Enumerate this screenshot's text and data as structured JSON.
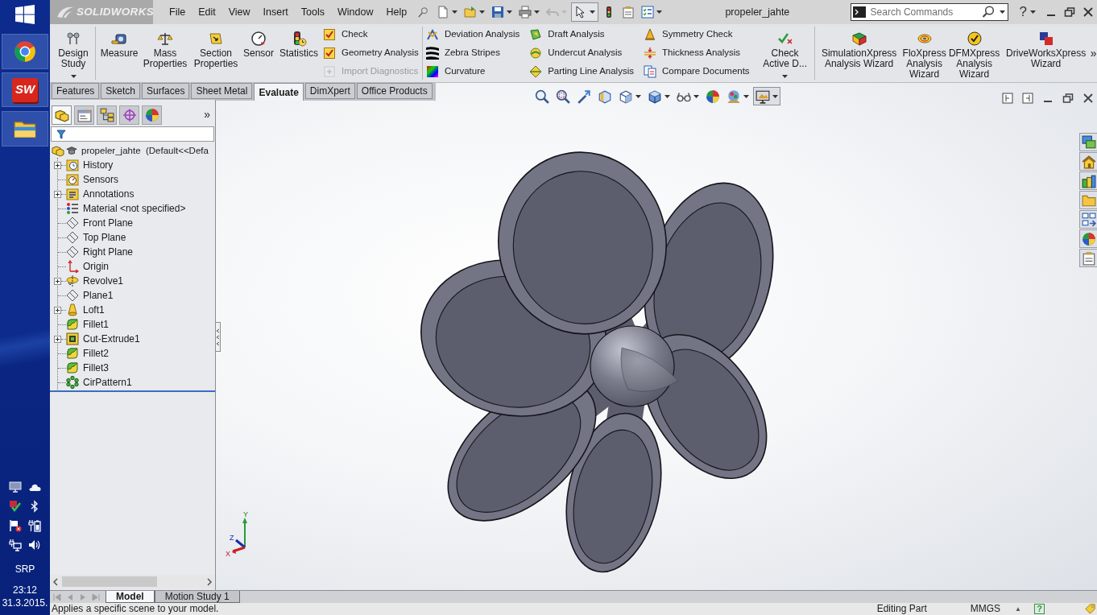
{
  "taskbar": {
    "app_badge": "SW",
    "language": "SRP",
    "time": "23:12",
    "date": "31.3.2015."
  },
  "title_bar": {
    "logo_text": "SOLIDWORKS",
    "menus": [
      "File",
      "Edit",
      "View",
      "Insert",
      "Tools",
      "Window",
      "Help"
    ],
    "quick_access": [
      {
        "kind": "new",
        "pressed": false,
        "disabled": false
      },
      {
        "kind": "open",
        "pressed": false,
        "disabled": false
      },
      {
        "kind": "save",
        "pressed": false,
        "disabled": false
      },
      {
        "kind": "print",
        "pressed": false,
        "disabled": false
      },
      {
        "kind": "undo",
        "pressed": false,
        "disabled": true
      },
      {
        "kind": "select",
        "pressed": true,
        "disabled": false
      },
      {
        "kind": "rebuild",
        "pressed": false,
        "disabled": false
      },
      {
        "kind": "options",
        "pressed": false,
        "disabled": false
      },
      {
        "kind": "list",
        "pressed": false,
        "disabled": false
      }
    ],
    "document_title": "propeler_jahte",
    "search": {
      "placeholder": "Search Commands"
    },
    "help": "?"
  },
  "ribbon": {
    "groups": [
      {
        "items": [
          {
            "kind": "large",
            "label": "Design Study",
            "dropdown": true
          }
        ]
      },
      {
        "items": [
          {
            "kind": "large",
            "label": "Measure",
            "dropdown": false
          },
          {
            "kind": "large",
            "label": "Mass Properties",
            "dropdown": false
          },
          {
            "kind": "large",
            "label": "Section Properties",
            "dropdown": false
          },
          {
            "kind": "large",
            "label": "Sensor",
            "dropdown": false
          },
          {
            "kind": "large",
            "label": "Statistics",
            "dropdown": false
          },
          {
            "kind": "stack",
            "buttons": [
              {
                "label": "Check",
                "disabled": false
              },
              {
                "label": "Geometry Analysis",
                "disabled": false
              },
              {
                "label": "Import Diagnostics",
                "disabled": true
              }
            ]
          }
        ]
      },
      {
        "items": [
          {
            "kind": "stack",
            "buttons": [
              {
                "label": "Deviation Analysis",
                "disabled": false
              },
              {
                "label": "Zebra Stripes",
                "disabled": false
              },
              {
                "label": "Curvature",
                "disabled": false
              }
            ]
          },
          {
            "kind": "stack",
            "buttons": [
              {
                "label": "Draft Analysis",
                "disabled": false
              },
              {
                "label": "Undercut Analysis",
                "disabled": false
              },
              {
                "label": "Parting Line Analysis",
                "disabled": false
              }
            ]
          },
          {
            "kind": "stack",
            "buttons": [
              {
                "label": "Symmetry Check",
                "disabled": false
              },
              {
                "label": "Thickness Analysis",
                "disabled": false
              },
              {
                "label": "Compare Documents",
                "disabled": false
              }
            ]
          },
          {
            "kind": "large",
            "label": "Check Active D...",
            "dropdown": true
          }
        ]
      },
      {
        "items": [
          {
            "kind": "large",
            "label": "SimulationXpress Analysis Wizard",
            "dropdown": false
          },
          {
            "kind": "large",
            "label": "FloXpress Analysis Wizard",
            "dropdown": false
          },
          {
            "kind": "large",
            "label": "DFMXpress Analysis Wizard",
            "dropdown": false
          },
          {
            "kind": "large",
            "label": "DriveWorksXpress Wizard",
            "dropdown": false
          }
        ]
      }
    ],
    "more": "»"
  },
  "tabs": [
    {
      "label": "Features",
      "selected": false
    },
    {
      "label": "Sketch",
      "selected": false
    },
    {
      "label": "Surfaces",
      "selected": false
    },
    {
      "label": "Sheet Metal",
      "selected": false
    },
    {
      "label": "Evaluate",
      "selected": true
    },
    {
      "label": "DimXpert",
      "selected": false
    },
    {
      "label": "Office Products",
      "selected": false
    }
  ],
  "feature_manager": {
    "tabs": [
      {
        "kind": "features",
        "selected": true
      },
      {
        "kind": "properties",
        "selected": false
      },
      {
        "kind": "configurations",
        "selected": false
      },
      {
        "kind": "dimxpert",
        "selected": false
      },
      {
        "kind": "display",
        "selected": false
      }
    ],
    "more": "»",
    "tree": {
      "kind": "part",
      "label": "propeler_jahte  (Default<<Defa",
      "children": [
        {
          "kind": "history",
          "label": "History",
          "expanded": false
        },
        {
          "kind": "sensors",
          "label": "Sensors"
        },
        {
          "kind": "annotations",
          "label": "Annotations",
          "expanded": false
        },
        {
          "kind": "material",
          "label": "Material <not specified>"
        },
        {
          "kind": "plane",
          "label": "Front Plane"
        },
        {
          "kind": "plane",
          "label": "Top Plane"
        },
        {
          "kind": "plane",
          "label": "Right Plane"
        },
        {
          "kind": "origin",
          "label": "Origin"
        },
        {
          "kind": "revolve",
          "label": "Revolve1",
          "expanded": false
        },
        {
          "kind": "plane",
          "label": "Plane1"
        },
        {
          "kind": "loft",
          "label": "Loft1",
          "expanded": false
        },
        {
          "kind": "fillet",
          "label": "Fillet1"
        },
        {
          "kind": "cut",
          "label": "Cut-Extrude1",
          "expanded": false
        },
        {
          "kind": "fillet",
          "label": "Fillet2"
        },
        {
          "kind": "fillet",
          "label": "Fillet3"
        },
        {
          "kind": "pattern",
          "label": "CirPattern1"
        }
      ]
    }
  },
  "view_toolbar": [
    {
      "kind": "fit",
      "pressed": false
    },
    {
      "kind": "area",
      "pressed": false
    },
    {
      "kind": "previous",
      "pressed": false
    },
    {
      "kind": "section",
      "pressed": false
    },
    {
      "kind": "orientation",
      "pressed": false
    },
    {
      "kind": "style",
      "pressed": false
    },
    {
      "kind": "visibility",
      "pressed": false
    },
    {
      "kind": "appearance",
      "pressed": false
    },
    {
      "kind": "scene",
      "pressed": false
    },
    {
      "kind": "settings",
      "pressed": true
    }
  ],
  "triad": {
    "x": "X",
    "y": "Y",
    "z": "Z"
  },
  "model_tabs": [
    {
      "label": "Model",
      "selected": true
    },
    {
      "label": "Motion Study 1",
      "selected": false
    }
  ],
  "status_bar": {
    "hint": "Applies a specific scene to your model.",
    "mode": "Editing Part",
    "units": "MMGS",
    "units_arrow": "▲",
    "help": "?"
  }
}
